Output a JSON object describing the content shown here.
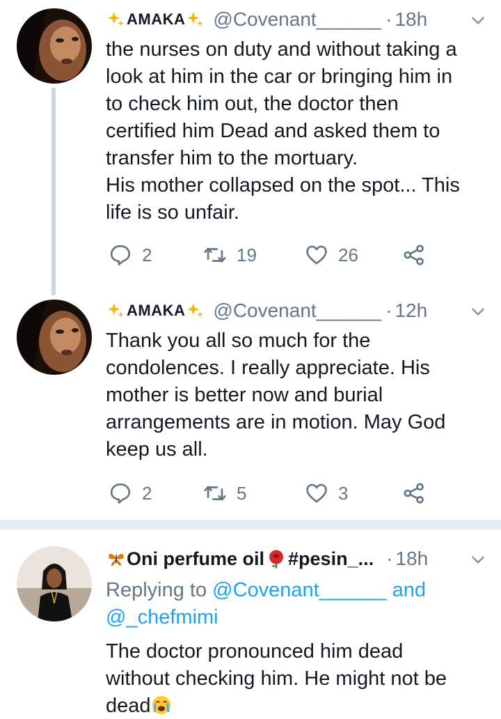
{
  "tweets": [
    {
      "name": "AMAKA",
      "handle": "@Covenant______",
      "dot": "·",
      "time": "18h",
      "lines": [
        "the nurses on duty and without taking a",
        "look at him in the car or bringing him in",
        "to check him out, the doctor then",
        "certified him Dead and asked them to",
        "transfer him to the mortuary.",
        "His mother collapsed on the spot... This",
        "life is so unfair."
      ],
      "replies": "2",
      "retweets": "19",
      "likes": "26"
    },
    {
      "name": "AMAKA",
      "handle": "@Covenant______",
      "dot": "·",
      "time": "12h",
      "lines": [
        "Thank you all so much for the",
        "condolences. I really appreciate. His",
        "mother is better now and burial",
        "arrangements are in motion. May God",
        "keep us all."
      ],
      "replies": "2",
      "retweets": "5",
      "likes": "3"
    },
    {
      "name": "Oni perfume oil",
      "name_suffix": " #pesin_...",
      "dot": "·",
      "time": "18h",
      "reply_prefix": "Replying to ",
      "reply_user1": "@Covenant______",
      "reply_and": " and",
      "reply_user2": "@_chefmimi",
      "lines": [
        "The doctor pronounced him dead",
        "without checking him. He might not be"
      ],
      "last_line": "dead"
    }
  ],
  "colors": {
    "text": "#141823",
    "secondary": "#657786",
    "link": "#1da1f2",
    "sparkle": "#f5b50b",
    "separator": "#e6ecf0",
    "thread_line": "#cfd8de"
  },
  "icons": [
    "sparkle-icon",
    "reply-icon",
    "retweet-icon",
    "like-icon",
    "share-icon",
    "chevron-down-icon",
    "butterfly-icon",
    "rose-icon",
    "crying-face-icon"
  ]
}
